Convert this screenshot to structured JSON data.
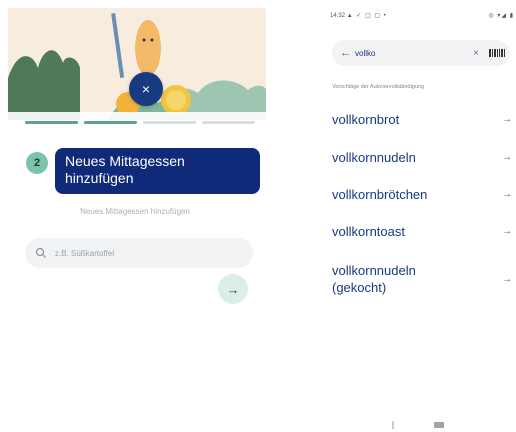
{
  "left_screen": {
    "close_icon_glyph": "×",
    "progress": {
      "total_steps": 4,
      "completed_steps": 2
    },
    "step": {
      "number": "2",
      "title": "Neues Mittagessen hinzufügen",
      "subtitle": "Neues Mittagessen hinzufügen"
    },
    "search": {
      "placeholder": "z.B. Süßkartoffel",
      "value": ""
    },
    "next_button_glyph": "→"
  },
  "right_screen": {
    "status_bar": {
      "time": "14:32",
      "left_icons": "▲ ✓ ▢ ▢ •",
      "right_icons": "◎ ▾◢ ▮"
    },
    "search": {
      "back_glyph": "←",
      "value": "vollko",
      "clear_glyph": "×"
    },
    "suggestions_title": "Vorschläge der Autovervollständigung",
    "suggestions": [
      {
        "label": "vollkornbrot",
        "arrow": "→"
      },
      {
        "label": "vollkornnudeln",
        "arrow": "→"
      },
      {
        "label": "vollkornbrötchen",
        "arrow": "→"
      },
      {
        "label": "vollkorntoast",
        "arrow": "→"
      },
      {
        "label": "vollkornnudeln (gekocht)",
        "arrow": "→"
      }
    ]
  },
  "colors": {
    "primary": "#102a7a",
    "accent": "#7cc4a8",
    "hero_bg": "#f7ecdd"
  }
}
